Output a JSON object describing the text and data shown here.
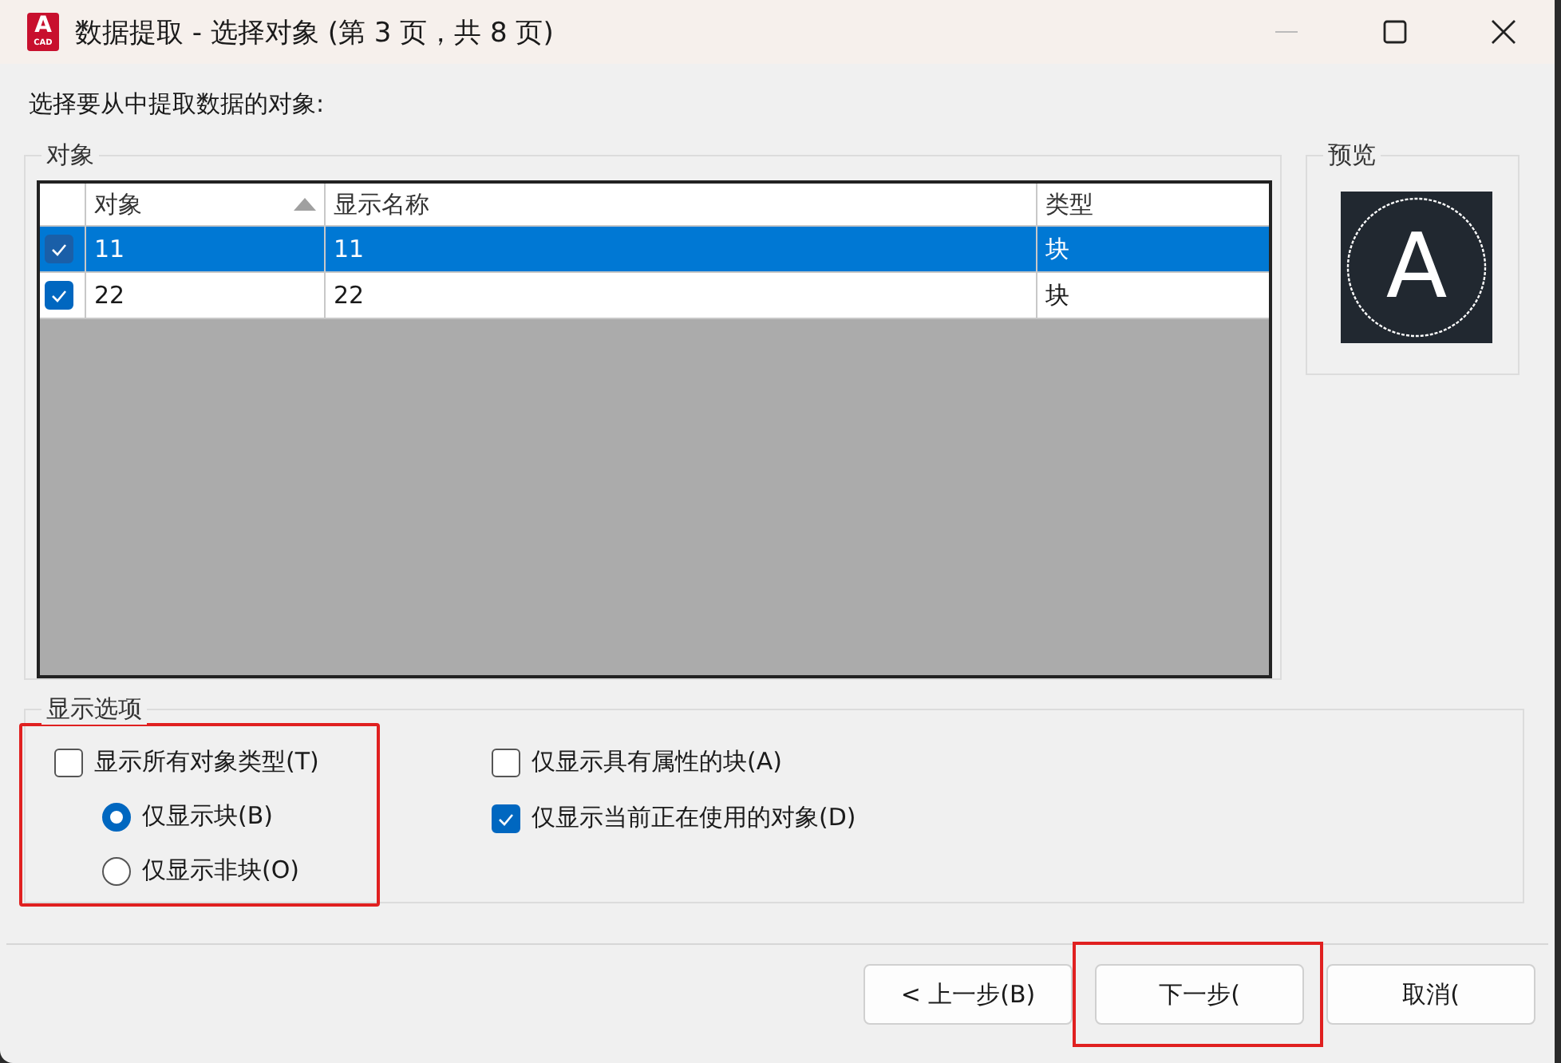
{
  "window": {
    "title": "数据提取 - 选择对象 (第 3 页，共 8 页)",
    "app_icon": {
      "letter": "A",
      "caption": "CAD"
    }
  },
  "prompt": "选择要从中提取数据的对象:",
  "objects": {
    "label": "对象",
    "columns": [
      {
        "label": "对象",
        "sorted": true
      },
      {
        "label": "显示名称",
        "sorted": false
      },
      {
        "label": "类型",
        "sorted": false
      }
    ],
    "rows": [
      {
        "checked": true,
        "selected": true,
        "cells": [
          "11",
          "11",
          "块"
        ]
      },
      {
        "checked": true,
        "selected": false,
        "cells": [
          "22",
          "22",
          "块"
        ]
      }
    ]
  },
  "preview": {
    "label": "预览",
    "glyph": "A"
  },
  "display_options": {
    "label": "显示选项",
    "highlighted": true,
    "left": [
      {
        "kind": "checkbox",
        "label": "显示所有对象类型(T)",
        "checked": false,
        "children": [
          {
            "kind": "radio",
            "label": "仅显示块(B)",
            "selected": true
          },
          {
            "kind": "radio",
            "label": "仅显示非块(O)",
            "selected": false
          }
        ]
      }
    ],
    "right": [
      {
        "kind": "checkbox",
        "label": "仅显示具有属性的块(A)",
        "checked": false
      },
      {
        "kind": "checkbox",
        "label": "仅显示当前正在使用的对象(D)",
        "checked": true
      }
    ]
  },
  "buttons": [
    {
      "label": "< 上一步(B)",
      "highlighted": false
    },
    {
      "label": "下一步(",
      "highlighted": true
    },
    {
      "label": "取消(",
      "highlighted": false
    }
  ]
}
